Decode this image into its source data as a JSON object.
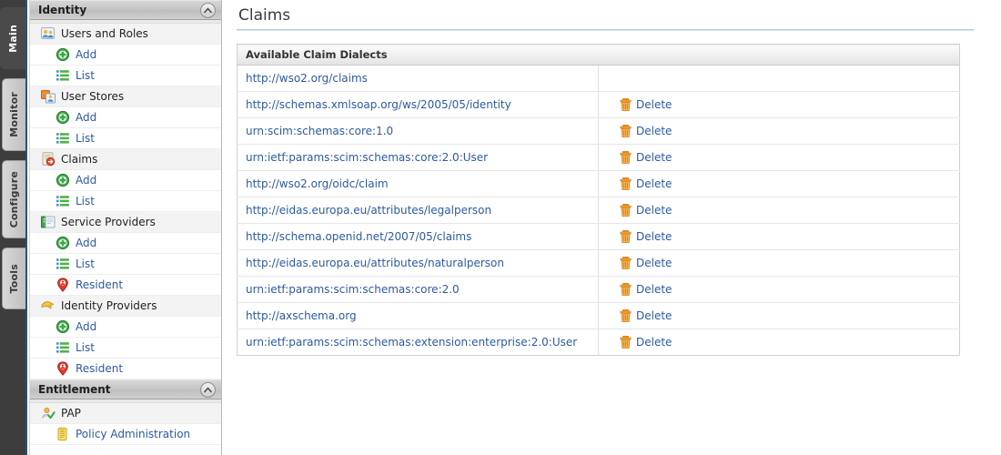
{
  "tab_rail": {
    "tabs": [
      {
        "id": "main",
        "label": "Main",
        "active": true
      },
      {
        "id": "monitor",
        "label": "Monitor",
        "active": false
      },
      {
        "id": "configure",
        "label": "Configure",
        "active": false
      },
      {
        "id": "tools",
        "label": "Tools",
        "active": false
      }
    ]
  },
  "sidebar": {
    "identity": {
      "header": "Identity",
      "collapse_icon": "chevron-up-circle-icon",
      "groups": [
        {
          "icon": "users-and-roles-icon",
          "label": "Users and Roles",
          "children": [
            {
              "icon": "add-green-plus-icon",
              "label": "Add"
            },
            {
              "icon": "list-icon",
              "label": "List"
            }
          ]
        },
        {
          "icon": "user-stores-icon",
          "label": "User Stores",
          "children": [
            {
              "icon": "add-green-plus-icon",
              "label": "Add"
            },
            {
              "icon": "list-icon",
              "label": "List"
            }
          ]
        },
        {
          "icon": "claims-icon",
          "label": "Claims",
          "children": [
            {
              "icon": "add-green-plus-icon",
              "label": "Add"
            },
            {
              "icon": "list-icon",
              "label": "List"
            }
          ]
        },
        {
          "icon": "service-providers-icon",
          "label": "Service Providers",
          "children": [
            {
              "icon": "add-green-plus-icon",
              "label": "Add"
            },
            {
              "icon": "list-icon",
              "label": "List"
            },
            {
              "icon": "resident-red-icon",
              "label": "Resident"
            }
          ]
        },
        {
          "icon": "identity-providers-icon",
          "label": "Identity Providers",
          "children": [
            {
              "icon": "add-green-plus-icon",
              "label": "Add"
            },
            {
              "icon": "list-icon",
              "label": "List"
            },
            {
              "icon": "resident-red-icon",
              "label": "Resident"
            }
          ]
        }
      ]
    },
    "entitlement": {
      "header": "Entitlement",
      "collapse_icon": "chevron-up-circle-icon",
      "groups": [
        {
          "icon": "pap-user-check-icon",
          "label": "PAP",
          "children": [
            {
              "icon": "policy-scroll-icon",
              "label": "Policy Administration"
            }
          ]
        }
      ]
    }
  },
  "content": {
    "title": "Claims",
    "table": {
      "header": "Available Claim Dialects",
      "delete_label": "Delete",
      "delete_icon": "trash-icon",
      "rows": [
        {
          "dialect": "http://wso2.org/claims",
          "deletable": false
        },
        {
          "dialect": "http://schemas.xmlsoap.org/ws/2005/05/identity",
          "deletable": true
        },
        {
          "dialect": "urn:scim:schemas:core:1.0",
          "deletable": true
        },
        {
          "dialect": "urn:ietf:params:scim:schemas:core:2.0:User",
          "deletable": true
        },
        {
          "dialect": "http://wso2.org/oidc/claim",
          "deletable": true
        },
        {
          "dialect": "http://eidas.europa.eu/attributes/legalperson",
          "deletable": true
        },
        {
          "dialect": "http://schema.openid.net/2007/05/claims",
          "deletable": true
        },
        {
          "dialect": "http://eidas.europa.eu/attributes/naturalperson",
          "deletable": true
        },
        {
          "dialect": "urn:ietf:params:scim:schemas:core:2.0",
          "deletable": true
        },
        {
          "dialect": "http://axschema.org",
          "deletable": true
        },
        {
          "dialect": "urn:ietf:params:scim:schemas:extension:enterprise:2.0:User",
          "deletable": true
        }
      ]
    }
  },
  "colors": {
    "link": "#2c5aa0",
    "rail_background": "#3d3d3d",
    "rail_accent": "#2f4e7a",
    "title_rule": "#b3c5e0",
    "trash_orange": "#e8821e",
    "add_green": "#34a032"
  }
}
